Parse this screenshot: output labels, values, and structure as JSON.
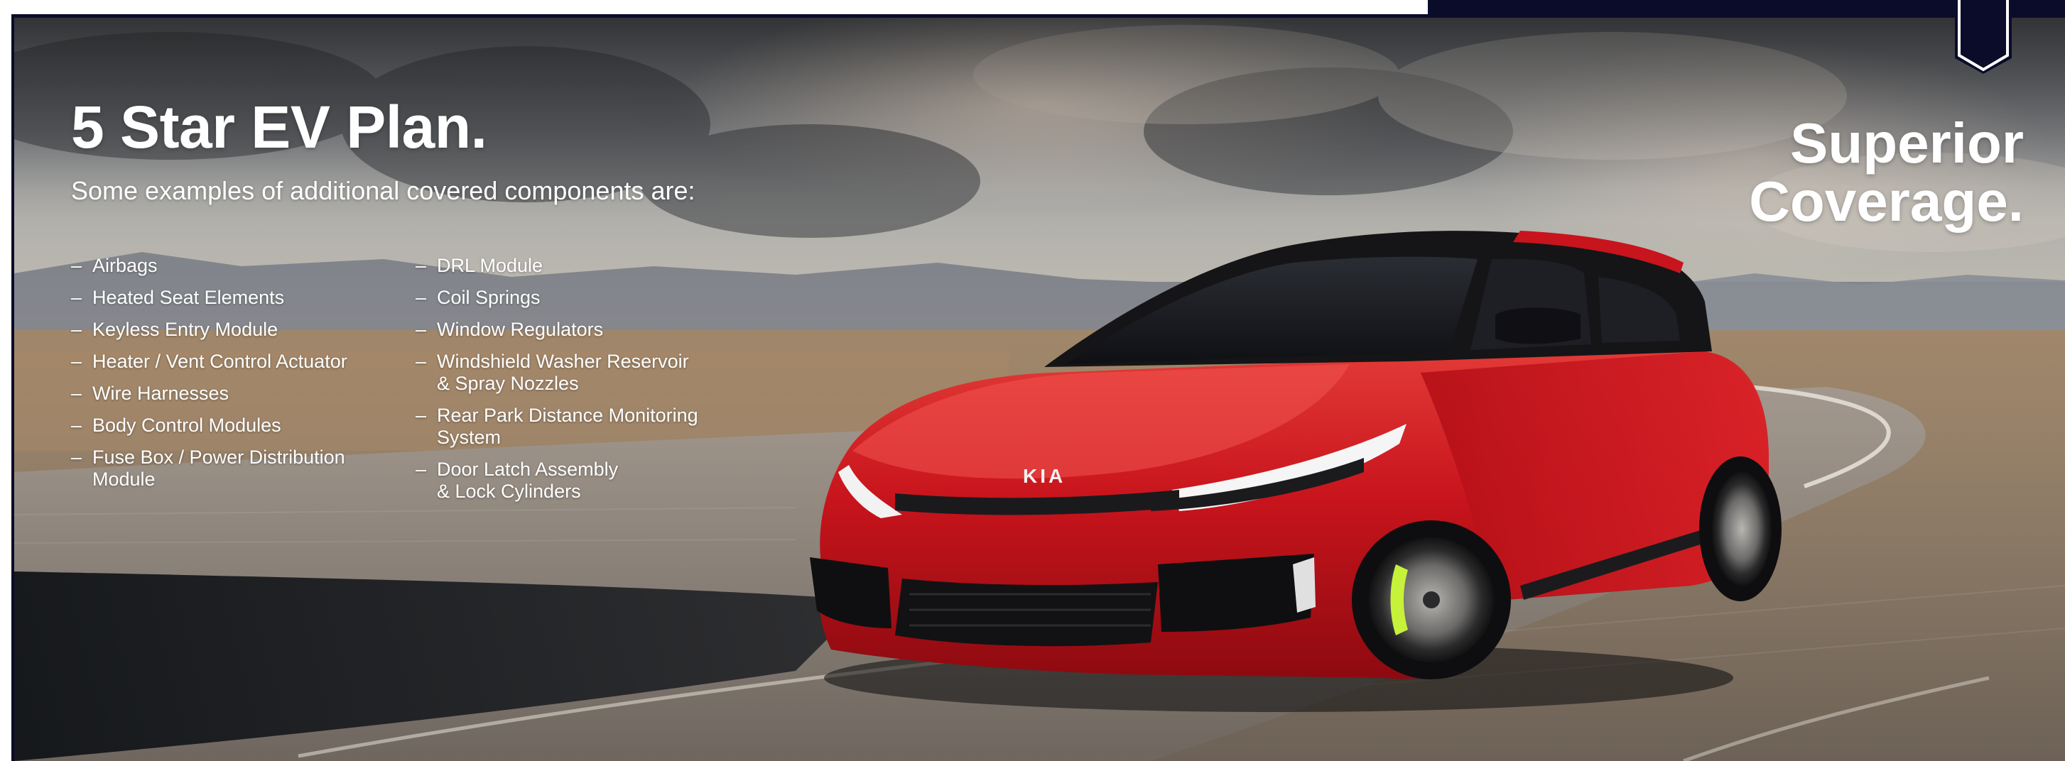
{
  "brand": {
    "navy": "#0b0c2a",
    "car_red": "#c8141c",
    "caliper_green": "#c6f23a"
  },
  "header": {
    "title": "5 Star EV Plan.",
    "subtitle": "Some examples of additional covered components are:"
  },
  "tagline": {
    "line1": "Superior",
    "line2": "Coverage."
  },
  "components": {
    "column1": [
      {
        "lines": [
          "Airbags"
        ]
      },
      {
        "lines": [
          "Heated Seat Elements"
        ]
      },
      {
        "lines": [
          "Keyless Entry Module"
        ]
      },
      {
        "lines": [
          "Heater / Vent Control Actuator"
        ]
      },
      {
        "lines": [
          "Wire Harnesses"
        ]
      },
      {
        "lines": [
          "Body Control Modules"
        ]
      },
      {
        "lines": [
          "Fuse Box / Power Distribution",
          "Module"
        ]
      }
    ],
    "column2": [
      {
        "lines": [
          "DRL Module"
        ]
      },
      {
        "lines": [
          "Coil Springs"
        ]
      },
      {
        "lines": [
          "Window Regulators"
        ]
      },
      {
        "lines": [
          "Windshield Washer Reservoir",
          "& Spray Nozzles"
        ]
      },
      {
        "lines": [
          "Rear Park Distance Monitoring",
          "System"
        ]
      },
      {
        "lines": [
          "Door Latch Assembly",
          "& Lock Cylinders"
        ]
      }
    ],
    "bullet": "–"
  },
  "car": {
    "badge": "KIA",
    "icon": "car-photo"
  }
}
